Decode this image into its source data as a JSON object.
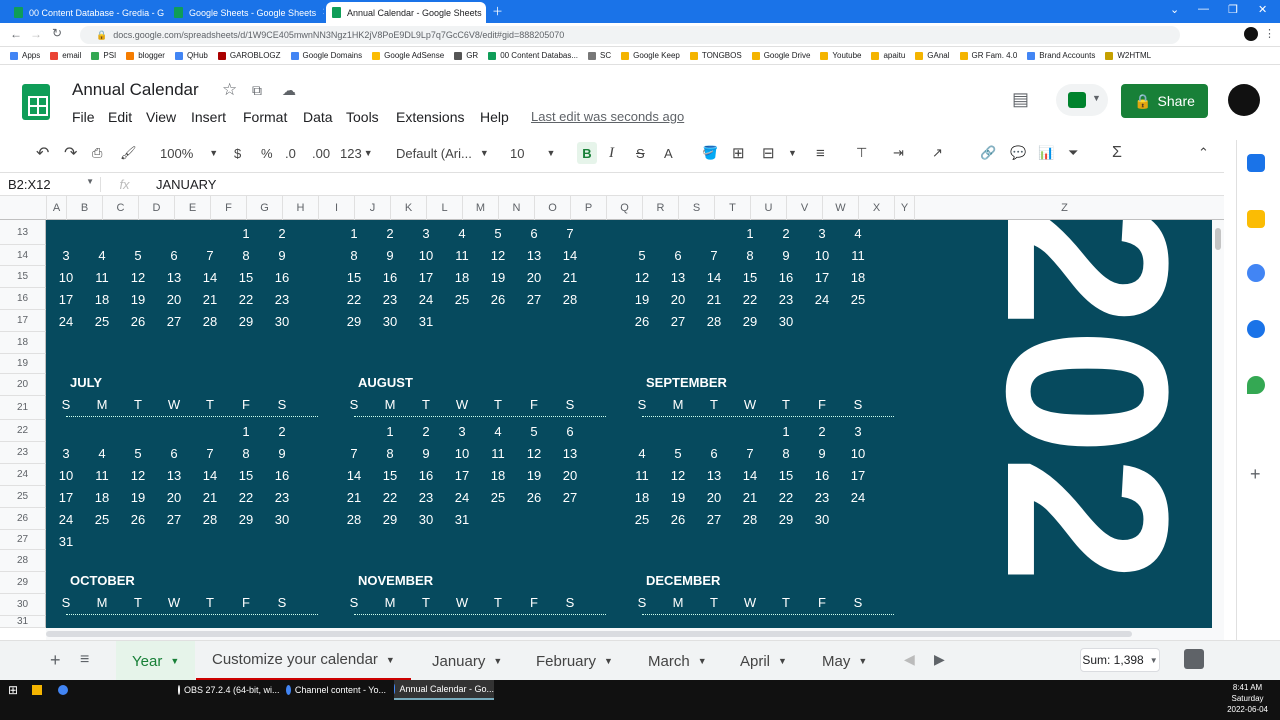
{
  "browser": {
    "tabs": [
      {
        "title": "00 Content Database - Gredia - G",
        "active": false
      },
      {
        "title": "Google Sheets - Google Sheets",
        "active": false
      },
      {
        "title": "Annual Calendar - Google Sheets",
        "active": true
      }
    ],
    "url": "docs.google.com/spreadsheets/d/1W9CE405mwnNN3Ngz1HK2jV8PoE9DL9Lp7q7GcC6V8/edit#gid=888205070",
    "bookmarks": [
      "Apps",
      "email",
      "PSI",
      "blogger",
      "QHub",
      "GAROBLOGZ",
      "Google Domains",
      "Google AdSense",
      "GR",
      "00 Content Databas...",
      "SC",
      "Google Keep",
      "TONGBOS",
      "Google Drive",
      "Youtube",
      "apaitu",
      "GAnal",
      "GR Fam. 4.0",
      "Brand Accounts",
      "W2HTML"
    ]
  },
  "doc": {
    "title": "Annual Calendar",
    "menus": [
      "File",
      "Edit",
      "View",
      "Insert",
      "Format",
      "Data",
      "Tools",
      "Extensions",
      "Help"
    ],
    "last_edit": "Last edit was seconds ago",
    "share_label": "Share"
  },
  "toolbar": {
    "zoom": "100%",
    "currency": "$",
    "percent": "%",
    "dec_decrease": ".0",
    "dec_increase": ".00",
    "format_more": "123",
    "font": "Default (Ari...",
    "font_size": "10"
  },
  "formula_bar": {
    "name_box": "B2:X12",
    "fx": "fx",
    "content": "JANUARY"
  },
  "columns": [
    "A",
    "B",
    "C",
    "D",
    "E",
    "F",
    "G",
    "H",
    "I",
    "J",
    "K",
    "L",
    "M",
    "N",
    "O",
    "P",
    "Q",
    "R",
    "S",
    "T",
    "U",
    "V",
    "W",
    "X",
    "Y",
    "Z"
  ],
  "rows": [
    "13",
    "14",
    "15",
    "16",
    "17",
    "18",
    "19",
    "20",
    "21",
    "22",
    "23",
    "24",
    "25",
    "26",
    "27",
    "28",
    "29",
    "30",
    "31"
  ],
  "calendar": {
    "dow": [
      "S",
      "M",
      "T",
      "W",
      "T",
      "F",
      "S"
    ],
    "top_partial": [
      {
        "weeks": [
          [
            "",
            "",
            "",
            "",
            "",
            "1",
            "2"
          ],
          [
            "3",
            "4",
            "5",
            "6",
            "7",
            "8",
            "9"
          ],
          [
            "10",
            "11",
            "12",
            "13",
            "14",
            "15",
            "16"
          ],
          [
            "17",
            "18",
            "19",
            "20",
            "21",
            "22",
            "23"
          ],
          [
            "24",
            "25",
            "26",
            "27",
            "28",
            "29",
            "30"
          ]
        ]
      },
      {
        "weeks": [
          [
            "1",
            "2",
            "3",
            "4",
            "5",
            "6",
            "7"
          ],
          [
            "8",
            "9",
            "10",
            "11",
            "12",
            "13",
            "14"
          ],
          [
            "15",
            "16",
            "17",
            "18",
            "19",
            "20",
            "21"
          ],
          [
            "22",
            "23",
            "24",
            "25",
            "26",
            "27",
            "28"
          ],
          [
            "29",
            "30",
            "31",
            "",
            "",
            "",
            ""
          ]
        ]
      },
      {
        "weeks": [
          [
            "",
            "",
            "",
            "1",
            "2",
            "3",
            "4"
          ],
          [
            "5",
            "6",
            "7",
            "8",
            "9",
            "10",
            "11"
          ],
          [
            "12",
            "13",
            "14",
            "15",
            "16",
            "17",
            "18"
          ],
          [
            "19",
            "20",
            "21",
            "22",
            "23",
            "24",
            "25"
          ],
          [
            "26",
            "27",
            "28",
            "29",
            "30",
            "",
            ""
          ]
        ]
      }
    ],
    "months": [
      {
        "name": "JULY",
        "weeks": [
          [
            "",
            "",
            "",
            "",
            "",
            "1",
            "2"
          ],
          [
            "3",
            "4",
            "5",
            "6",
            "7",
            "8",
            "9"
          ],
          [
            "10",
            "11",
            "12",
            "13",
            "14",
            "15",
            "16"
          ],
          [
            "17",
            "18",
            "19",
            "20",
            "21",
            "22",
            "23"
          ],
          [
            "24",
            "25",
            "26",
            "27",
            "28",
            "29",
            "30"
          ],
          [
            "31",
            "",
            "",
            "",
            "",
            "",
            ""
          ]
        ]
      },
      {
        "name": "AUGUST",
        "weeks": [
          [
            "",
            "1",
            "2",
            "3",
            "4",
            "5",
            "6"
          ],
          [
            "7",
            "8",
            "9",
            "10",
            "11",
            "12",
            "13"
          ],
          [
            "14",
            "15",
            "16",
            "17",
            "18",
            "19",
            "20"
          ],
          [
            "21",
            "22",
            "23",
            "24",
            "25",
            "26",
            "27"
          ],
          [
            "28",
            "29",
            "30",
            "31",
            "",
            "",
            ""
          ]
        ]
      },
      {
        "name": "SEPTEMBER",
        "weeks": [
          [
            "",
            "",
            "",
            "",
            "1",
            "2",
            "3"
          ],
          [
            "4",
            "5",
            "6",
            "7",
            "8",
            "9",
            "10"
          ],
          [
            "11",
            "12",
            "13",
            "14",
            "15",
            "16",
            "17"
          ],
          [
            "18",
            "19",
            "20",
            "21",
            "22",
            "23",
            "24"
          ],
          [
            "25",
            "26",
            "27",
            "28",
            "29",
            "30",
            ""
          ]
        ]
      }
    ],
    "bottom_labels": [
      "OCTOBER",
      "NOVEMBER",
      "DECEMBER"
    ],
    "year_text": "202"
  },
  "sheet_tabs": [
    {
      "label": "Year",
      "active": true
    },
    {
      "label": "Customize your calendar",
      "active": false
    },
    {
      "label": "January",
      "active": false
    },
    {
      "label": "February",
      "active": false
    },
    {
      "label": "March",
      "active": false
    },
    {
      "label": "April",
      "active": false
    },
    {
      "label": "May",
      "active": false
    }
  ],
  "sum": "Sum: 1,398",
  "taskbar": {
    "items": [
      "OBS 27.2.4 (64-bit, wi...",
      "Channel content - Yo...",
      "Annual Calendar - Go..."
    ],
    "time": "8:41 AM",
    "day": "Saturday",
    "date": "2022-06-04"
  }
}
